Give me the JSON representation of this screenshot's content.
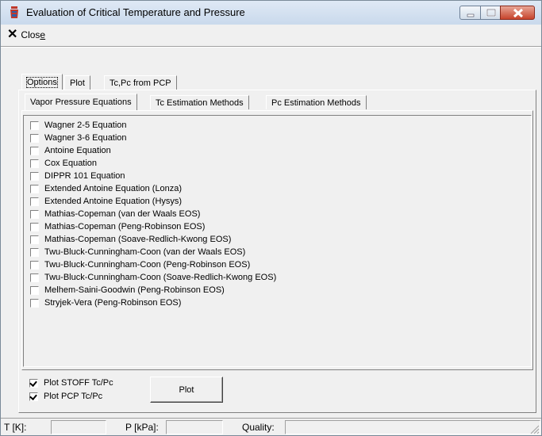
{
  "window": {
    "title": "Evaluation of Critical Temperature and Pressure",
    "icon": "app-icon"
  },
  "toolbar": {
    "close_label": "Close"
  },
  "main_tabs": [
    {
      "label": "Options"
    },
    {
      "label": "Plot"
    },
    {
      "label": "Tc,Pc from PCP"
    }
  ],
  "sub_tabs": [
    {
      "label": "Vapor Pressure Equations"
    },
    {
      "label": "Tc Estimation Methods"
    },
    {
      "label": "Pc Estimation Methods"
    }
  ],
  "equations": [
    {
      "label": "Wagner 2-5 Equation",
      "checked": false
    },
    {
      "label": "Wagner 3-6 Equation",
      "checked": false
    },
    {
      "label": "Antoine Equation",
      "checked": false
    },
    {
      "label": "Cox Equation",
      "checked": false
    },
    {
      "label": "DIPPR 101 Equation",
      "checked": false
    },
    {
      "label": "Extended Antoine Equation (Lonza)",
      "checked": false
    },
    {
      "label": "Extended Antoine Equation (Hysys)",
      "checked": false
    },
    {
      "label": "Mathias-Copeman (van der Waals EOS)",
      "checked": false
    },
    {
      "label": "Mathias-Copeman (Peng-Robinson EOS)",
      "checked": false
    },
    {
      "label": "Mathias-Copeman (Soave-Redlich-Kwong EOS)",
      "checked": false
    },
    {
      "label": "Twu-Bluck-Cunningham-Coon (van der Waals EOS)",
      "checked": false
    },
    {
      "label": "Twu-Bluck-Cunningham-Coon (Peng-Robinson EOS)",
      "checked": false
    },
    {
      "label": "Twu-Bluck-Cunningham-Coon (Soave-Redlich-Kwong EOS)",
      "checked": false
    },
    {
      "label": "Melhem-Saini-Goodwin (Peng-Robinson EOS)",
      "checked": false
    },
    {
      "label": "Stryjek-Vera (Peng-Robinson EOS)",
      "checked": false
    }
  ],
  "plot_options": [
    {
      "label": "Plot STOFF Tc/Pc",
      "checked": true
    },
    {
      "label": "Plot PCP Tc/Pc",
      "checked": true
    }
  ],
  "plot_button": {
    "label": "Plot"
  },
  "status": {
    "t_label": "T [K]:",
    "p_label": "P [kPa]:",
    "quality_label": "Quality:",
    "t_value": "",
    "p_value": "",
    "quality_value": ""
  }
}
